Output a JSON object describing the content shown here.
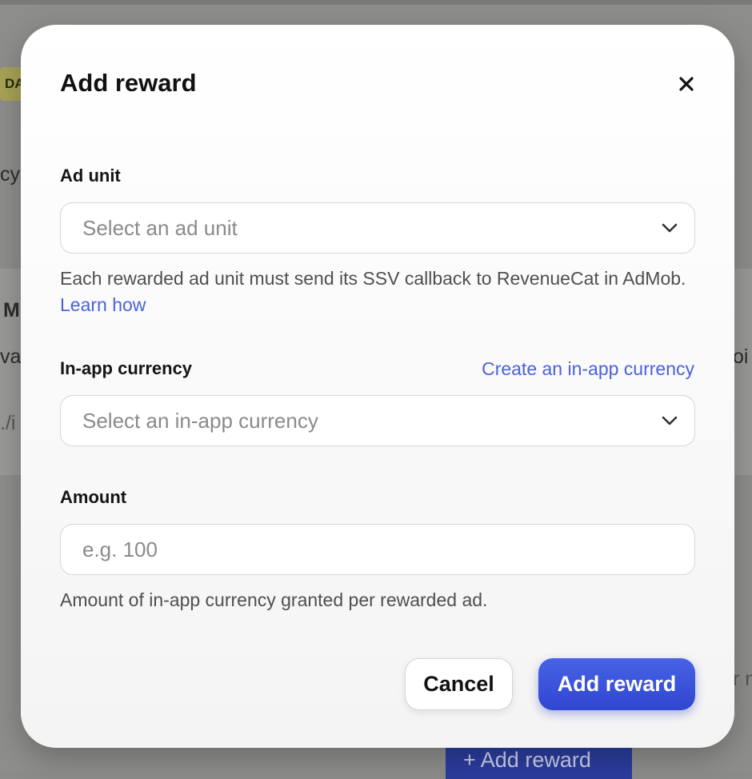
{
  "background": {
    "chip_text": "DA",
    "fragments": [
      "cy",
      "M",
      "va",
      "./i",
      "oi",
      "r n"
    ],
    "button_label": "+ Add reward"
  },
  "modal": {
    "title": "Add reward",
    "close_icon": "close-icon",
    "ad_unit": {
      "label": "Ad unit",
      "placeholder": "Select an ad unit",
      "help_text": "Each rewarded ad unit must send its SSV callback to RevenueCat in AdMob.",
      "help_link": "Learn how"
    },
    "currency": {
      "label": "In-app currency",
      "link": "Create an in-app currency",
      "placeholder": "Select an in-app currency"
    },
    "amount": {
      "label": "Amount",
      "placeholder": "e.g. 100",
      "value": "",
      "help_text": "Amount of in-app currency granted per rewarded ad."
    },
    "buttons": {
      "cancel": "Cancel",
      "submit": "Add reward"
    }
  },
  "colors": {
    "accent": "#3a55dc",
    "link": "#4a63d8",
    "overlay": "#8e8e8c"
  }
}
